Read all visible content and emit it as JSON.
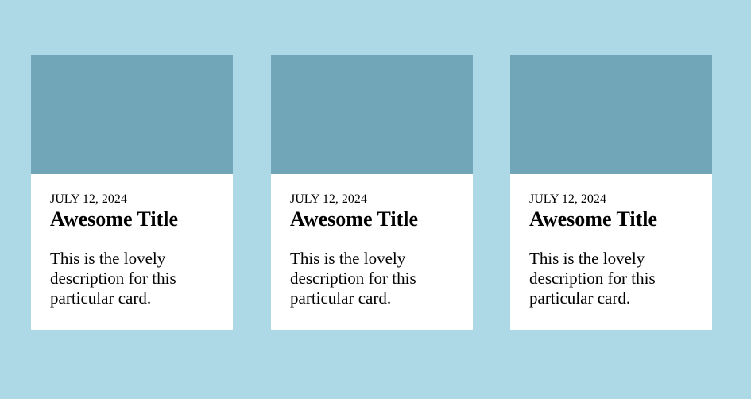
{
  "cards": [
    {
      "date": "JULY 12, 2024",
      "title": "Awesome Title",
      "description": "This is the lovely description for this particular card."
    },
    {
      "date": "JULY 12, 2024",
      "title": "Awesome Title",
      "description": "This is the lovely description for this particular card."
    },
    {
      "date": "JULY 12, 2024",
      "title": "Awesome Title",
      "description": "This is the lovely description for this particular card."
    }
  ]
}
